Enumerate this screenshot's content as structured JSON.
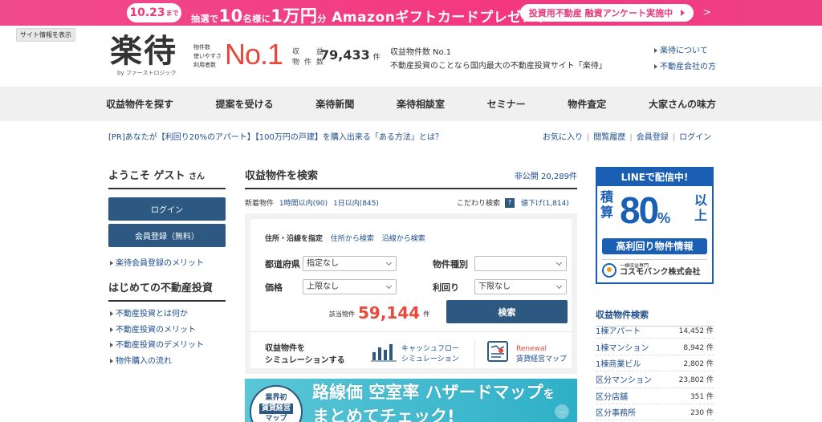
{
  "banner": {
    "date": "10.23",
    "date_suffix": "まで",
    "msg_a": "抽選で",
    "msg_num": "10",
    "msg_b": "名様に",
    "msg_amount": "1万円",
    "msg_unit": "分",
    "msg_c": " Amazonギフトカードプレゼント",
    "cta": "投資用不動産 融資アンケート実施中",
    "color": "#f04a8e"
  },
  "site_info_button": "サイト情報を表示",
  "header": {
    "logo": "楽待",
    "logo_sub": "by ファーストロジック",
    "no1_labels": [
      "物件数",
      "使いやすさ",
      "利用者数"
    ],
    "no1": "No.1",
    "count_labels": [
      "収　益",
      "物件数"
    ],
    "count_value": "79,433",
    "count_unit": "件",
    "tagline_1": "収益物件数 No.1",
    "tagline_2": "不動産投資のことなら国内最大の不動産投資サイト「楽待」",
    "links": [
      "楽待について",
      "不動産会社の方"
    ]
  },
  "nav": [
    "収益物件を探す",
    "提案を受ける",
    "楽待新聞",
    "楽待相談室",
    "セミナー",
    "物件査定",
    "大家さんの味方"
  ],
  "pr": "[PR]あなたが【利回り20%のアパート】【100万円の戸建】を購入出来る「ある方法」とは？",
  "util": [
    "お気に入り",
    "閲覧履歴",
    "会員登録",
    "ログイン"
  ],
  "left": {
    "welcome": "ようこそ ゲスト",
    "welcome_suffix": "さん",
    "login": "ログイン",
    "register": "会員登録（無料）",
    "merit": "楽待会員登録のメリット",
    "beginner_title": "はじめての不動産投資",
    "beginner_links": [
      "不動産投資とは何か",
      "不動産投資のメリット",
      "不動産投資のデメリット",
      "物件購入の流れ"
    ]
  },
  "center": {
    "title": "収益物件を検索",
    "private_label": "非公開",
    "private_count": "20,289件",
    "new_label": "新着物件",
    "new_1h": "1時間以内(90)",
    "new_1d": "1日以内(845)",
    "kodawari": "こだわり検索",
    "kodawari_q": "?",
    "price_down": "値下げ(1,814)",
    "tabs": {
      "active": "住所・沿線を指定",
      "station": "住所から検索",
      "line": "沿線から検索"
    },
    "fields": {
      "pref_label": "都道府県",
      "pref_value": "指定なし",
      "type_label": "物件種別",
      "type_value": "",
      "price_label": "価格",
      "price_value": "上限なし",
      "yield_label": "利回り",
      "yield_value": "下限なし"
    },
    "hits_label": "該当物件",
    "hits_count": "59,144",
    "hits_unit": "件",
    "search_button": "検索",
    "sim_label_1": "収益物件を",
    "sim_label_2": "シミュレーションする",
    "sim_cf_1": "キャッシュフロー",
    "sim_cf_2": "シミュレーション",
    "sim_renewal": "Renewal",
    "sim_map": "賃貸経営マップ"
  },
  "bottom_banner": {
    "badge_1": "業界初",
    "badge_2": "賃貸経営",
    "badge_3": "マップ",
    "line1_a": "路線価",
    "line1_b": "空室率",
    "line1_c": "ハザードマップ",
    "line1_d": "を",
    "line2": "まとめてチェック!",
    "more": "…"
  },
  "right": {
    "ad_top": "LINEで配信中!",
    "ad_seki": "積算",
    "ad_pct": "80",
    "ad_pct_sign": "%",
    "ad_ijou": "以上",
    "ad_info": "高利回り物件情報",
    "ad_co_small": "一棟収益専門",
    "ad_co": "コスモバンク株式会社",
    "list_title": "収益物件検索",
    "list": [
      {
        "name": "1棟アパート",
        "count": "14,452 件"
      },
      {
        "name": "1棟マンション",
        "count": "8,942 件"
      },
      {
        "name": "1棟商業ビル",
        "count": "2,802 件"
      },
      {
        "name": "区分マンション",
        "count": "23,802 件"
      },
      {
        "name": "区分店舗",
        "count": "351 件"
      },
      {
        "name": "区分事務所",
        "count": "230 件"
      }
    ]
  }
}
